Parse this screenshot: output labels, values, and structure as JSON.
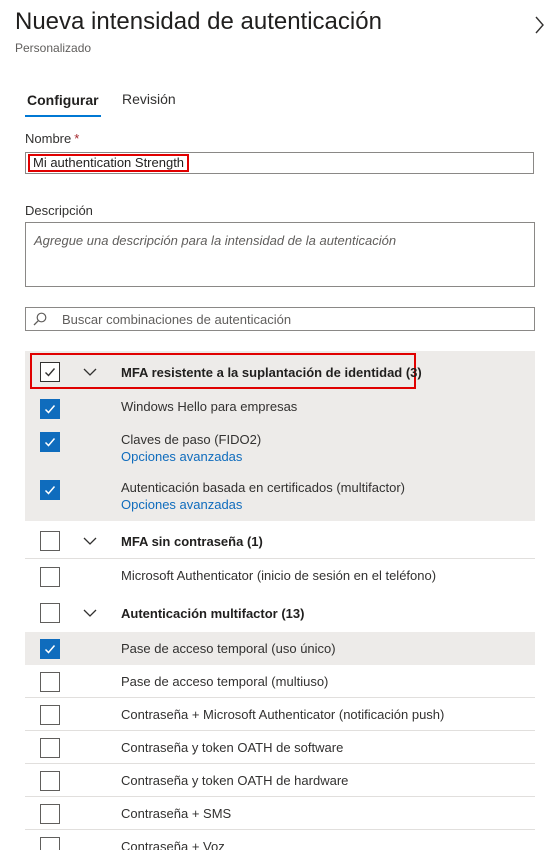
{
  "header": {
    "title": "Nueva intensidad de autenticación",
    "subtitle": "Personalizado"
  },
  "tabs": [
    {
      "label": "Configurar",
      "active": true
    },
    {
      "label": "Revisión",
      "active": false
    }
  ],
  "form": {
    "name_label": "Nombre",
    "required_mark": "*",
    "name_value": "Mi authentication Strength",
    "description_label": "Descripción",
    "description_placeholder": "Agregue una descripción para la intensidad de la autenticación",
    "search_placeholder": "Buscar combinaciones de autenticación"
  },
  "groups": [
    {
      "label": "MFA resistente a la suplantación de identidad (3)",
      "checked": true,
      "highlighted": true,
      "items": [
        {
          "label": "Windows Hello para empresas",
          "checked": true
        },
        {
          "label": "Claves de paso (FIDO2)",
          "checked": true,
          "link": "Opciones avanzadas"
        },
        {
          "label": "Autenticación basada en certificados (multifactor)",
          "checked": true,
          "link": "Opciones avanzadas"
        }
      ]
    },
    {
      "label": "MFA sin contraseña (1)",
      "checked": false,
      "items": [
        {
          "label": "Microsoft Authenticator (inicio de sesión en el teléfono)",
          "checked": false
        }
      ]
    },
    {
      "label": "Autenticación multifactor (13)",
      "checked": false,
      "items": [
        {
          "label": "Pase de acceso temporal (uso único)",
          "checked": true
        },
        {
          "label": "Pase de acceso temporal (multiuso)",
          "checked": false
        },
        {
          "label": "Contraseña + Microsoft Authenticator (notificación push)",
          "checked": false
        },
        {
          "label": "Contraseña y token OATH de software",
          "checked": false
        },
        {
          "label": "Contraseña y token OATH de hardware",
          "checked": false
        },
        {
          "label": "Contraseña + SMS",
          "checked": false
        },
        {
          "label": "Contraseña + Voz",
          "checked": false
        }
      ]
    }
  ],
  "colors": {
    "accent": "#0f6cbd",
    "highlight_frame": "#e00000",
    "shaded_row": "#edebe9"
  }
}
